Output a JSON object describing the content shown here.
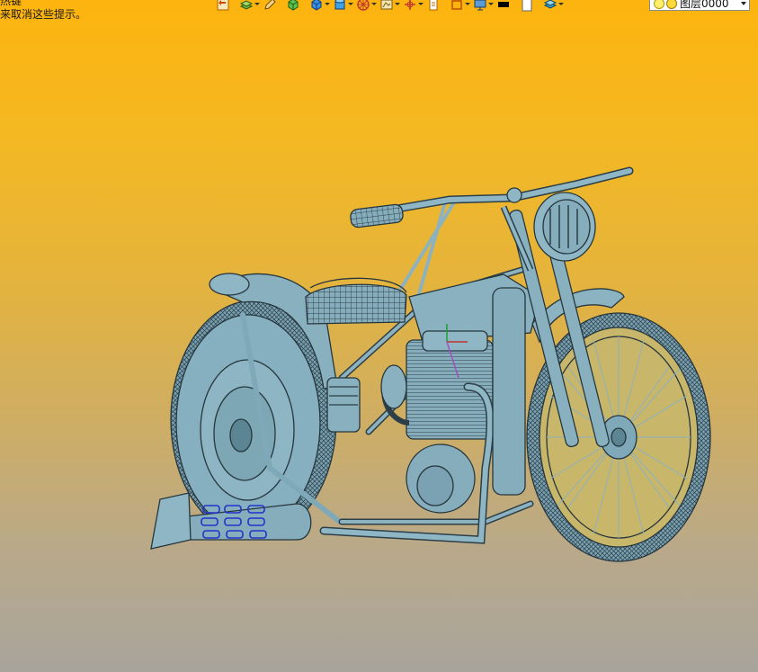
{
  "hint": {
    "line1": "热键",
    "line2": "来取消这些提示。"
  },
  "toolbar": {
    "buttons": [
      {
        "icon": "undo-icon",
        "has_dropdown": false
      },
      {
        "icon": "layer-stack-icon",
        "has_dropdown": true
      },
      {
        "icon": "pencil-icon",
        "has_dropdown": false
      },
      {
        "icon": "green-cube-icon",
        "has_dropdown": false
      },
      {
        "icon": "blue-cube-icon",
        "has_dropdown": true
      },
      {
        "icon": "cylinder-icon",
        "has_dropdown": true
      },
      {
        "icon": "wheel-icon",
        "has_dropdown": true
      },
      {
        "icon": "view-icon",
        "has_dropdown": true
      },
      {
        "icon": "axes-icon",
        "has_dropdown": true
      },
      {
        "icon": "clipboard-icon",
        "has_dropdown": false
      },
      {
        "icon": "frame-icon",
        "has_dropdown": true
      },
      {
        "icon": "display-icon",
        "has_dropdown": true
      },
      {
        "icon": "black-color-swatch-icon",
        "has_dropdown": false
      },
      {
        "icon": "white-color-swatch-icon",
        "has_dropdown": false
      },
      {
        "icon": "layers-icon",
        "has_dropdown": true
      }
    ]
  },
  "layer_selector": {
    "value": "图层0000"
  },
  "viewport": {
    "model": "motorcycle-3d-model",
    "background_top": "#fdb40e",
    "background_bottom": "#a8a49c",
    "model_color": "#7fa9b8"
  }
}
